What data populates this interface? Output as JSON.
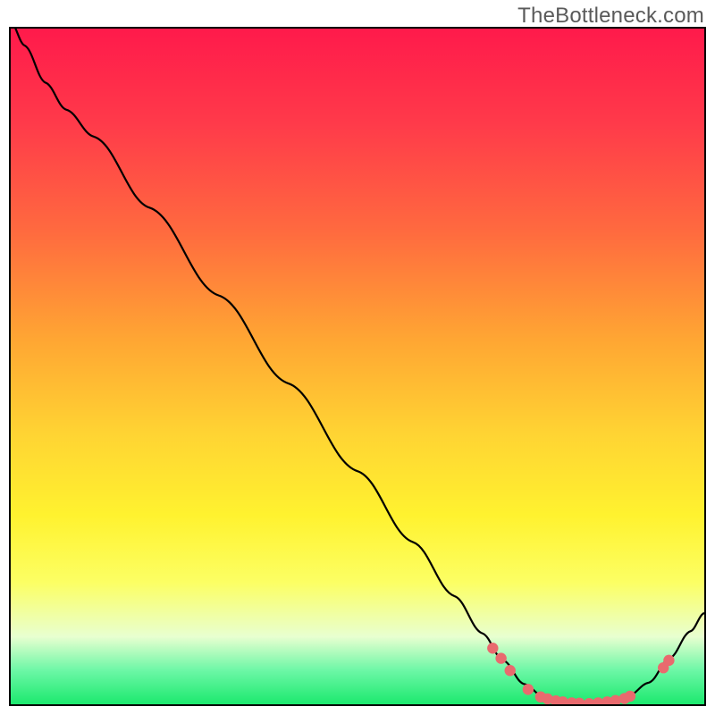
{
  "watermark": "TheBottleneck.com",
  "chart_data": {
    "type": "line",
    "title": "",
    "xlabel": "",
    "ylabel": "",
    "xlim": [
      0,
      100
    ],
    "ylim": [
      0,
      100
    ],
    "curve": [
      {
        "x": 0.0,
        "y": 101.0
      },
      {
        "x": 2.0,
        "y": 97.5
      },
      {
        "x": 5.0,
        "y": 92.0
      },
      {
        "x": 8.0,
        "y": 88.0
      },
      {
        "x": 12.0,
        "y": 84.0
      },
      {
        "x": 20.0,
        "y": 73.5
      },
      {
        "x": 30.0,
        "y": 60.5
      },
      {
        "x": 40.0,
        "y": 47.5
      },
      {
        "x": 50.0,
        "y": 34.5
      },
      {
        "x": 58.0,
        "y": 24.0
      },
      {
        "x": 64.0,
        "y": 16.0
      },
      {
        "x": 68.0,
        "y": 10.5
      },
      {
        "x": 71.0,
        "y": 6.5
      },
      {
        "x": 74.0,
        "y": 3.0
      },
      {
        "x": 77.0,
        "y": 1.0
      },
      {
        "x": 80.0,
        "y": 0.2
      },
      {
        "x": 83.0,
        "y": 0.0
      },
      {
        "x": 86.0,
        "y": 0.3
      },
      {
        "x": 89.0,
        "y": 1.2
      },
      {
        "x": 92.0,
        "y": 3.2
      },
      {
        "x": 95.0,
        "y": 6.8
      },
      {
        "x": 98.0,
        "y": 10.8
      },
      {
        "x": 100.0,
        "y": 13.5
      }
    ],
    "dots": [
      {
        "x": 69.5,
        "y": 8.3
      },
      {
        "x": 70.7,
        "y": 6.8
      },
      {
        "x": 72.0,
        "y": 5.0
      },
      {
        "x": 74.6,
        "y": 2.2
      },
      {
        "x": 76.4,
        "y": 1.1
      },
      {
        "x": 77.4,
        "y": 0.8
      },
      {
        "x": 78.6,
        "y": 0.5
      },
      {
        "x": 79.6,
        "y": 0.35
      },
      {
        "x": 80.9,
        "y": 0.2
      },
      {
        "x": 82.0,
        "y": 0.15
      },
      {
        "x": 83.4,
        "y": 0.1
      },
      {
        "x": 84.7,
        "y": 0.2
      },
      {
        "x": 86.0,
        "y": 0.35
      },
      {
        "x": 87.2,
        "y": 0.55
      },
      {
        "x": 88.5,
        "y": 0.85
      },
      {
        "x": 89.3,
        "y": 1.2
      },
      {
        "x": 94.1,
        "y": 5.4
      },
      {
        "x": 94.9,
        "y": 6.5
      }
    ],
    "colors": {
      "curve": "#000000",
      "dot": "#e96a6e",
      "gradient_top": "#ff1a4b",
      "gradient_mid": "#ffe23a",
      "gradient_bottom": "#1ce96e"
    }
  }
}
